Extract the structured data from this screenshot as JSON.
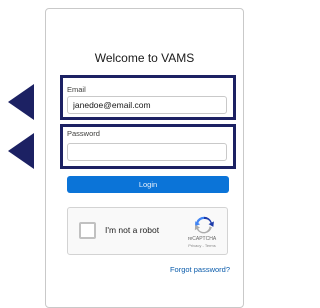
{
  "page": {
    "title": "Welcome to VAMS"
  },
  "email": {
    "label": "Email",
    "value": "janedoe@email.com"
  },
  "password": {
    "label": "Password",
    "value": ""
  },
  "login": {
    "label": "Login"
  },
  "captcha": {
    "label": "I'm not a robot",
    "brand": "reCAPTCHA",
    "links": "Privacy - Terms"
  },
  "forgot_password": {
    "label": "Forgot password?"
  },
  "colors": {
    "highlight": "#1c2163",
    "button": "#0b74d8",
    "link": "#0b5cab"
  },
  "icons": {
    "highlight_pointer": "triangle-arrow-right-pointing",
    "captcha_logo": "recaptcha-logo"
  }
}
